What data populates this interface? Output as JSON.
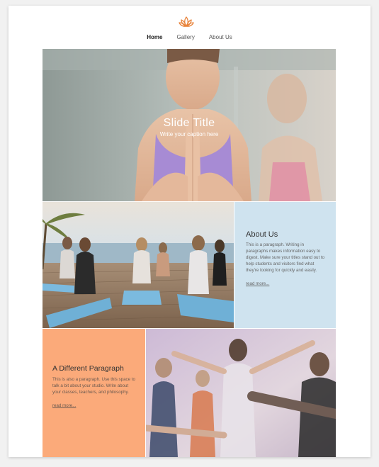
{
  "nav": {
    "logo_icon": "lotus-icon",
    "items": [
      {
        "label": "Home",
        "active": true
      },
      {
        "label": "Gallery",
        "active": false
      },
      {
        "label": "About Us",
        "active": false
      }
    ]
  },
  "hero": {
    "title": "Slide Title",
    "caption": "Write your caption here"
  },
  "about": {
    "title": "About Us",
    "text": "This is a paragraph. Writing in paragraphs makes information easy to digest. Make sure your titles stand out to help students and visitors find what they're looking for quickly and easily.",
    "link": "read more..."
  },
  "paragraph": {
    "title": "A Different Paragraph",
    "text": "This is also a paragraph. Use this space to talk a bit about your studio. Write about your classes, teachers, and philosophy.",
    "link": "read more..."
  },
  "colors": {
    "accent": "#e8833a",
    "about_bg": "#cfe3ef",
    "paragraph_bg": "#fbaa7a"
  }
}
